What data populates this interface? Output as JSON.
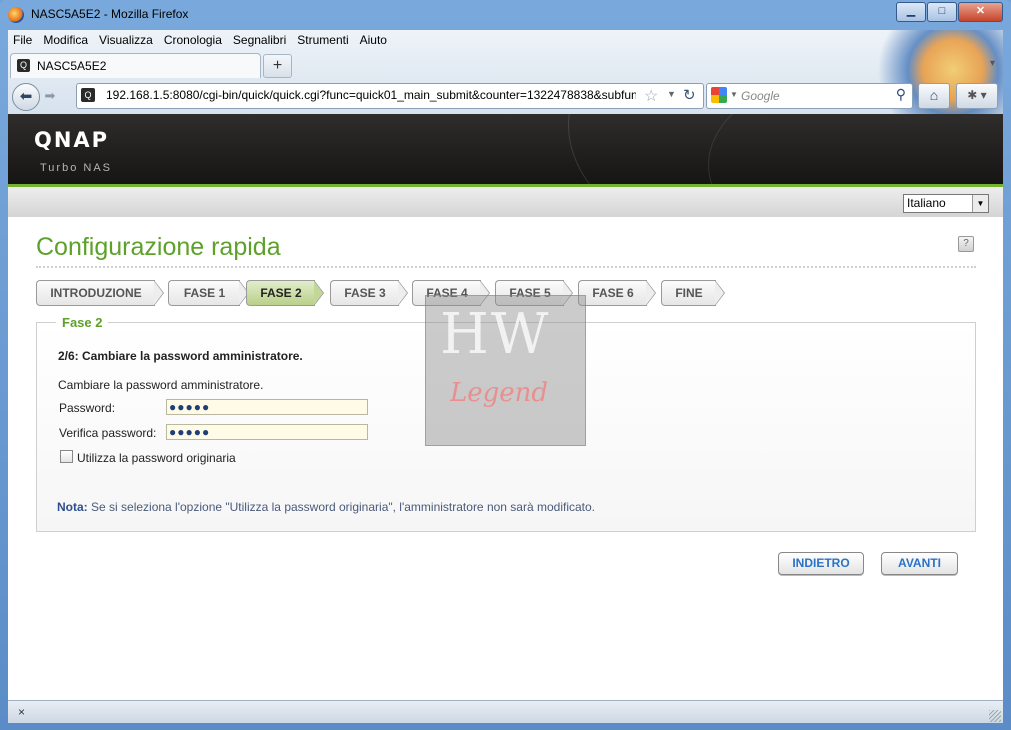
{
  "window": {
    "title": "NASC5A5E2 - Mozilla Firefox"
  },
  "menu": [
    "File",
    "Modifica",
    "Visualizza",
    "Cronologia",
    "Segnalibri",
    "Strumenti",
    "Aiuto"
  ],
  "tab": {
    "label": "NASC5A5E2",
    "new_tab": "+"
  },
  "nav": {
    "url": "192.168.1.5:8080/cgi-bin/quick/quick.cgi?func=quick01_main_submit&counter=1322478838&subfun",
    "search_placeholder": "Google"
  },
  "brand": {
    "logo": "QNAP",
    "sub": "Turbo NAS"
  },
  "language": {
    "selected": "Italiano"
  },
  "page": {
    "title": "Configurazione rapida",
    "help": "?"
  },
  "steps": [
    {
      "label": "INTRODUZIONE",
      "active": false
    },
    {
      "label": "FASE 1",
      "active": false
    },
    {
      "label": "FASE 2",
      "active": true
    },
    {
      "label": "FASE 3",
      "active": false
    },
    {
      "label": "FASE 4",
      "active": false
    },
    {
      "label": "FASE 5",
      "active": false
    },
    {
      "label": "FASE 6",
      "active": false
    },
    {
      "label": "FINE",
      "active": false
    }
  ],
  "form": {
    "legend": "Fase 2",
    "step_desc": "2/6: Cambiare la password amministratore.",
    "sub_desc": "Cambiare la password amministratore.",
    "password_label": "Password:",
    "password_value": "●●●●●",
    "verify_label": "Verifica password:",
    "verify_value": "●●●●●",
    "checkbox_label": "Utilizza la password originaria",
    "checkbox_checked": false,
    "note_label": "Nota:",
    "note_text": " Se si seleziona l'opzione \"Utilizza la password originaria\", l'amministratore non sarà modificato."
  },
  "buttons": {
    "back": "INDIETRO",
    "next": "AVANTI"
  },
  "watermark": {
    "top": "HW",
    "bottom": "Legend"
  },
  "status": {
    "close": "×"
  },
  "colors": {
    "accent_green": "#5da12b",
    "link_blue": "#2a72c6"
  }
}
